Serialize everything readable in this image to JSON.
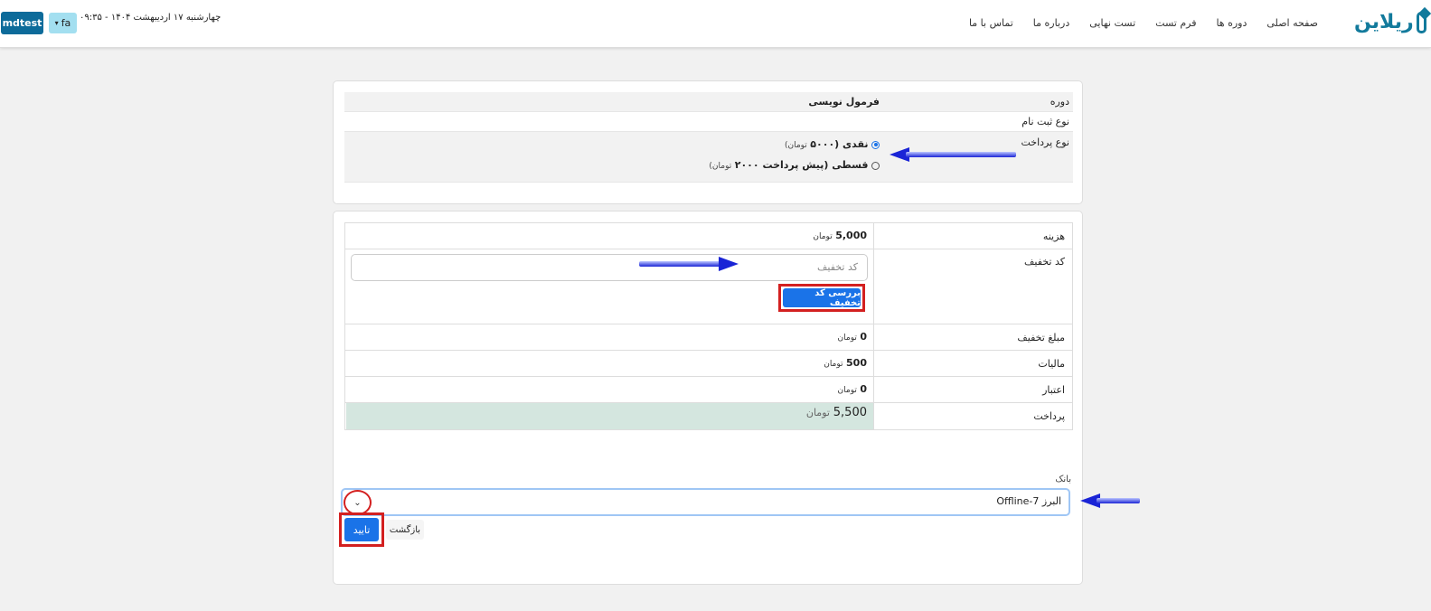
{
  "header": {
    "logo_text": "ریلاین",
    "nav": [
      "صفحه اصلی",
      "دوره ها",
      "فرم تست",
      "تست نهایی",
      "درباره ما",
      "تماس با ما"
    ],
    "datetime": "چهارشنبه ۱۷ اردیبهشت ۱۴۰۴ - ۰۹:۳۵",
    "lang_label": "fa",
    "user_label": "mdtest"
  },
  "course_card": {
    "course_label": "دوره",
    "course_value": "فرمول نویسی",
    "reg_type_label": "نوع ثبت نام",
    "payment_type_label": "نوع پرداخت",
    "options": [
      {
        "label": "نقدی (۵۰۰۰",
        "unit": "تومان)",
        "checked": true
      },
      {
        "label": "قسطی (پیش پرداخت ۲۰۰۰",
        "unit": "تومان)",
        "checked": false
      }
    ]
  },
  "payment_card": {
    "rows": {
      "cost": {
        "label": "هزینه",
        "value": "5,000",
        "unit": "تومان"
      },
      "discount_code": {
        "label": "کد تخفیف",
        "placeholder": "کد تخفیف",
        "button": "بررسی کد تخفیف"
      },
      "discount_amount": {
        "label": "مبلغ تخفیف",
        "value": "0",
        "unit": "تومان"
      },
      "tax": {
        "label": "مالیات",
        "value": "500",
        "unit": "تومان"
      },
      "credit": {
        "label": "اعتبار",
        "value": "0",
        "unit": "تومان"
      },
      "payment": {
        "label": "پرداخت",
        "value": "5,500",
        "unit": "تومان"
      }
    },
    "bank_label": "بانک",
    "bank_value": "Offline-7 البرز",
    "confirm_button": "تایید",
    "back_button": "بازگشت"
  },
  "colors": {
    "primary": "#1a73e8",
    "highlight": "#d32020",
    "arrow": "#1a24d6",
    "total_bg": "#d4e6df"
  }
}
